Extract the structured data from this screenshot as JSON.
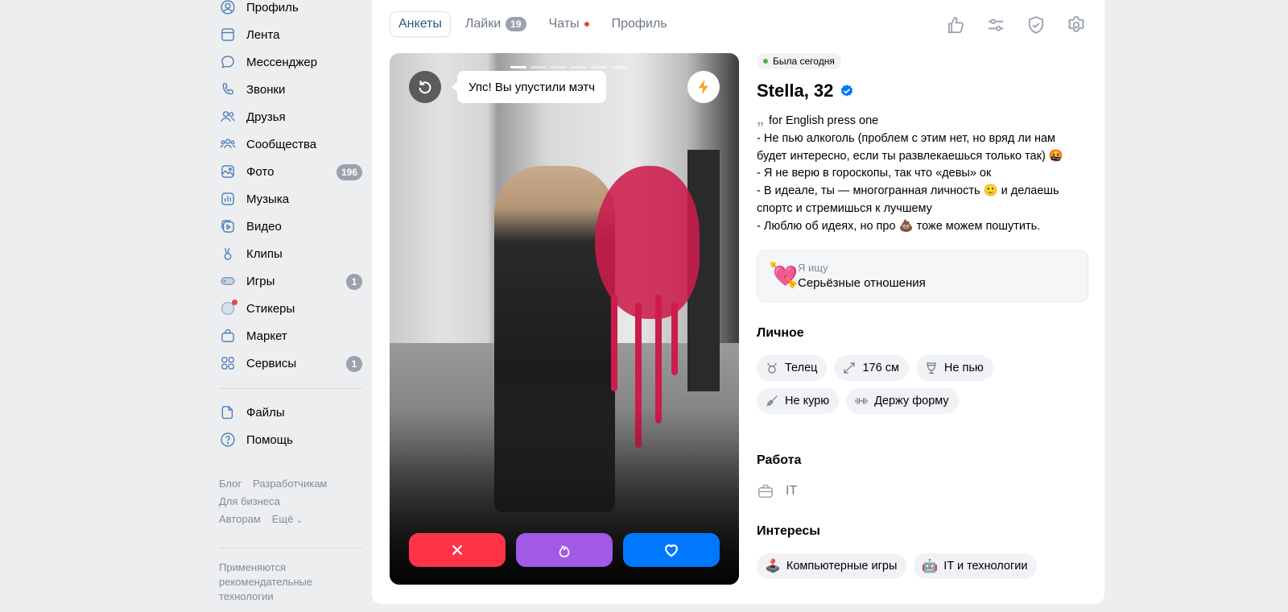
{
  "sidebar": {
    "items": [
      {
        "label": "Профиль",
        "icon": "user-circle-icon"
      },
      {
        "label": "Лента",
        "icon": "feed-icon"
      },
      {
        "label": "Мессенджер",
        "icon": "chat-bubble-icon"
      },
      {
        "label": "Звонки",
        "icon": "phone-icon"
      },
      {
        "label": "Друзья",
        "icon": "friends-icon"
      },
      {
        "label": "Сообщества",
        "icon": "groups-icon"
      },
      {
        "label": "Фото",
        "icon": "photo-icon",
        "badge": "196"
      },
      {
        "label": "Музыка",
        "icon": "music-icon"
      },
      {
        "label": "Видео",
        "icon": "video-icon"
      },
      {
        "label": "Клипы",
        "icon": "clips-icon"
      },
      {
        "label": "Игры",
        "icon": "games-icon",
        "badge": "1"
      },
      {
        "label": "Стикеры",
        "icon": "stickers-icon"
      },
      {
        "label": "Маркет",
        "icon": "market-bag-icon"
      },
      {
        "label": "Сервисы",
        "icon": "services-grid-icon",
        "badge": "1"
      }
    ],
    "secondary": [
      {
        "label": "Файлы",
        "icon": "file-icon"
      },
      {
        "label": "Помощь",
        "icon": "help-icon"
      }
    ],
    "footer_links": [
      "Блог",
      "Разработчикам",
      "Для бизнеса",
      "Авторам",
      "Ещё"
    ],
    "footer_note": "Применяются рекомендательные технологии"
  },
  "tabs": {
    "items": [
      {
        "label": "Анкеты",
        "active": true
      },
      {
        "label": "Лайки",
        "badge": "19"
      },
      {
        "label": "Чаты",
        "dot": true
      },
      {
        "label": "Профиль"
      }
    ],
    "icons": [
      "thumb-up-icon",
      "filters-icon",
      "shield-check-icon",
      "settings-gear-icon"
    ]
  },
  "photo": {
    "tooltip": "Упс! Вы упустили мэтч",
    "dots_total": 6,
    "dots_active": 1
  },
  "profile": {
    "status": "Была сегодня",
    "name": "Stella, 32",
    "bio_lines": [
      "for English press one",
      "- Не пью алкоголь (проблем с этим нет, но вряд ли нам будет интересно, если ты развлекаешься только так) 🤬",
      "- Я не верю в гороскопы, так что «девы» ок",
      "- В идеале, ты — многогранная личность 🙂 и делаешь спортс и стремишься к лучшему",
      "- Люблю об идеях, но про 💩 тоже можем пошутить."
    ],
    "looking_label": "Я ищу",
    "looking_value": "Серьёзные отношения",
    "looking_emoji": "💘",
    "personal_title": "Личное",
    "personal_chips": [
      {
        "label": "Телец",
        "icon": "taurus-icon"
      },
      {
        "label": "176 см",
        "icon": "height-arrows-icon"
      },
      {
        "label": "Не пью",
        "icon": "glass-icon"
      },
      {
        "label": "Не курю",
        "icon": "no-smoking-icon"
      },
      {
        "label": "Держу форму",
        "icon": "dumbbell-icon"
      }
    ],
    "work_title": "Работа",
    "work_value": "IT",
    "interests_title": "Интересы",
    "interests": [
      {
        "label": "Компьютерные игры",
        "emoji": "🕹️"
      },
      {
        "label": "IT и технологии",
        "emoji": "🤖"
      }
    ]
  },
  "colors": {
    "accent": "#447bba",
    "dislike": "#ff3347",
    "superlike": "#a259e6",
    "like": "#0077ff",
    "online": "#4bb34b"
  }
}
